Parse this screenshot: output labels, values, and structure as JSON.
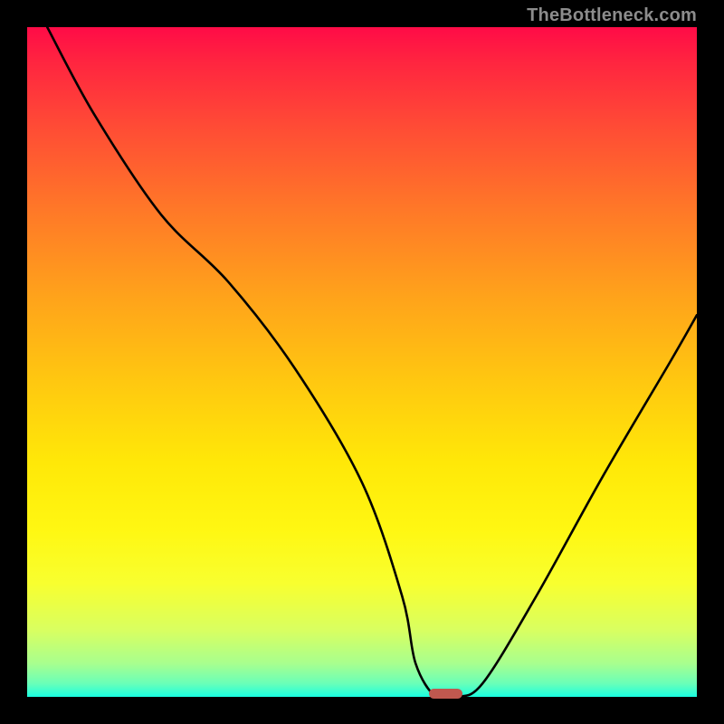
{
  "watermark": "TheBottleneck.com",
  "chart_data": {
    "type": "line",
    "title": "",
    "xlabel": "",
    "ylabel": "",
    "xlim": [
      0,
      100
    ],
    "ylim": [
      0,
      100
    ],
    "grid": false,
    "series": [
      {
        "name": "bottleneck-curve",
        "x": [
          3,
          10,
          20,
          30,
          40,
          50,
          56,
          58,
          61,
          64,
          68,
          76,
          86,
          96,
          100
        ],
        "values": [
          100,
          87,
          72,
          62,
          49,
          32,
          15,
          5,
          0,
          0,
          2,
          15,
          33,
          50,
          57
        ]
      }
    ],
    "annotations": [
      {
        "name": "optimum-marker",
        "x_start": 60,
        "x_end": 65,
        "y": 0.6
      }
    ],
    "colors": {
      "curve": "#000000",
      "marker": "#c0584f",
      "background_gradient_top": "#ff0b47",
      "background_gradient_bottom": "#1affe1"
    }
  }
}
